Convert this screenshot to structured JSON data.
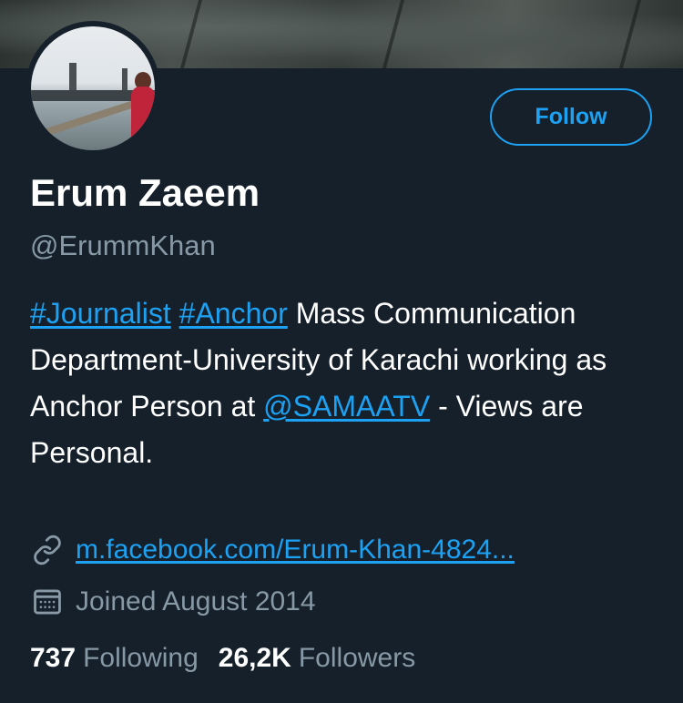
{
  "profile": {
    "name": "Erum Zaeem",
    "handle": "@ErummKhan",
    "follow_label": "Follow",
    "bio": {
      "tag1": "#Journalist",
      "tag2": "#Anchor",
      "text1": " Mass Communication Department-University of Karachi working as Anchor Person at ",
      "mention": "@SAMAATV",
      "text2": " - Views are Personal."
    },
    "website": "m.facebook.com/Erum-Khan-4824...",
    "joined": "Joined August 2014",
    "following_count": "737",
    "following_label": "Following",
    "followers_count": "26,2K",
    "followers_label": "Followers"
  },
  "icons": {
    "link": "link-icon",
    "calendar": "calendar-icon"
  },
  "colors": {
    "background": "#15202b",
    "accent": "#1da1f2",
    "secondary_text": "#8899a6",
    "primary_text": "#ffffff"
  }
}
